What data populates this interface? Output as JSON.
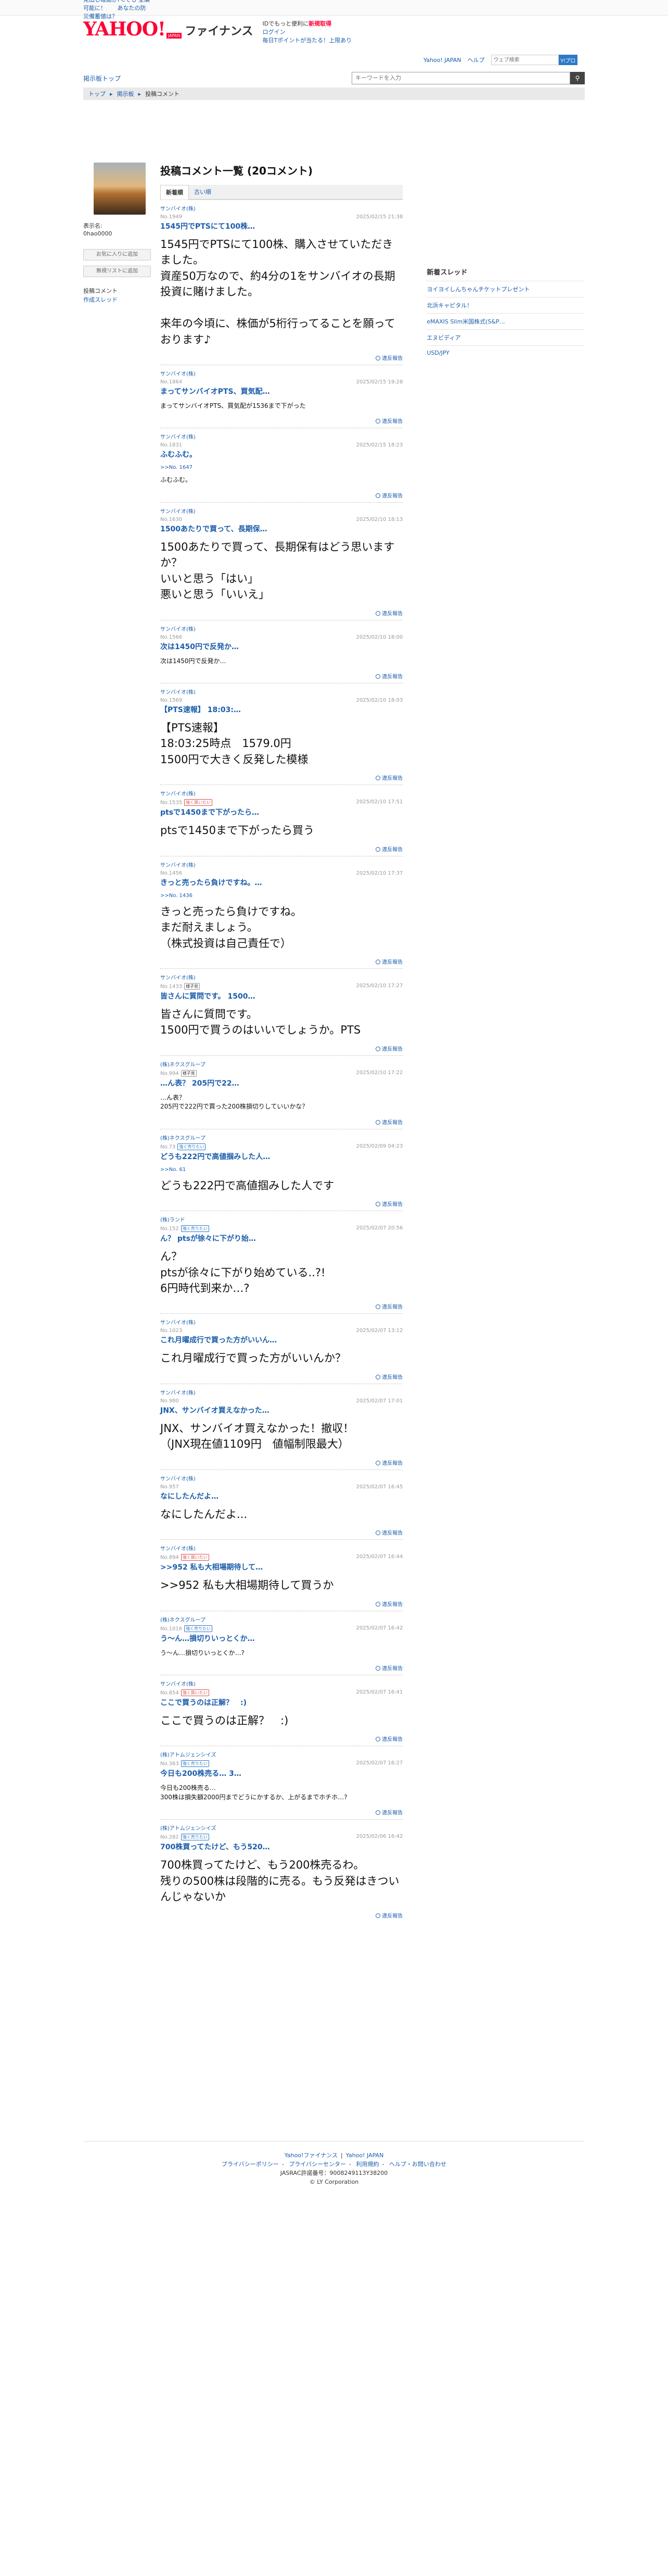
{
  "topbar": {
    "links": [
      "見出し確認がPCでも 全編可能に！",
      "あなたの防災備蓄値は？"
    ],
    "right_links": [
      "Yahoo! JAPAN",
      "ヘルプ"
    ],
    "search_placeholder": "ウェブ検索",
    "search_button": "Y!プロ"
  },
  "header": {
    "logo": "YAHOO!",
    "logo_japan": "JAPAN",
    "logo_sub": "ファイナンス",
    "info_line1": "IDでもっと便利に",
    "info_new": "新規取得",
    "info_line2": "ログイン",
    "info_line3": "毎日Tポイントが当たる！上限あり"
  },
  "nav": {
    "board_top": "掲示板トップ",
    "search_placeholder": "キーワードを入力"
  },
  "breadcrumb": [
    "トップ",
    "掲示板",
    "投稿コメント"
  ],
  "profile": {
    "name_label": "表示名:",
    "name": "0hao0000",
    "add_favorite": "お気に入りに追加",
    "add_ignore": "無視リストに追加",
    "link_comments": "投稿コメント",
    "link_threads": "作成スレッド"
  },
  "main": {
    "title": "投稿コメント一覧 (20コメント)",
    "tabs": [
      "新着順",
      "古い順"
    ],
    "report_label": "違反報告"
  },
  "posts": [
    {
      "stock": "サンバイオ(株)",
      "no": "No.1949",
      "date": "2025/02/15 21:38",
      "title": "1545円でPTSにて100株…",
      "badge": "",
      "reply": "",
      "size": "big",
      "body": "1545円でPTSにて100株、購入させていただきました。\n資産50万なので、約4分の1をサンバイオの長期投資に賭けました。\n\n来年の今頃に、株価が5桁行ってることを願っております♪"
    },
    {
      "stock": "サンバイオ(株)",
      "no": "No.1864",
      "date": "2025/02/15 19:28",
      "title": "まってサンバイオPTS、買気配…",
      "badge": "",
      "reply": "",
      "size": "small",
      "body": "まってサンバイオPTS、買気配が1536まで下がった"
    },
    {
      "stock": "サンバイオ(株)",
      "no": "No.1831",
      "date": "2025/02/15 18:23",
      "title": "ふむふむ。",
      "badge": "",
      "reply": ">>No. 1647",
      "size": "small",
      "body": "ふむふむ。"
    },
    {
      "stock": "サンバイオ(株)",
      "no": "No.1630",
      "date": "2025/02/10 18:13",
      "title": "1500あたりで買って、長期保…",
      "badge": "",
      "reply": "",
      "size": "big",
      "body": "1500あたりで買って、長期保有はどう思いますか？\nいいと思う「はい」\n悪いと思う「いいえ」"
    },
    {
      "stock": "サンバイオ(株)",
      "no": "No.1566",
      "date": "2025/02/10 18:00",
      "title": "次は1450円で反発か…",
      "badge": "",
      "reply": "",
      "size": "small",
      "body": "次は1450円で反発か…"
    },
    {
      "stock": "サンバイオ(株)",
      "no": "No.1569",
      "date": "2025/02/10 18:03",
      "title": "【PTS速報】 18:03:…",
      "badge": "",
      "reply": "",
      "size": "big",
      "body": "【PTS速報】\n18:03:25時点　1579.0円\n1500円で大きく反発した模様"
    },
    {
      "stock": "サンバイオ(株)",
      "no": "No.1535",
      "date": "2025/02/10 17:51",
      "title": "ptsで1450まで下がったら…",
      "badge": "強く買いたい",
      "reply": "",
      "size": "big",
      "body": "ptsで1450まで下がったら買う"
    },
    {
      "stock": "サンバイオ(株)",
      "no": "No.1456",
      "date": "2025/02/10 17:37",
      "title": "きっと売ったら負けですね。…",
      "badge": "",
      "reply": ">>No. 1436",
      "size": "big",
      "body": "きっと売ったら負けですね。\nまだ耐えましょう。\n（株式投資は自己責任で）"
    },
    {
      "stock": "サンバイオ(株)",
      "no": "No.1433",
      "date": "2025/02/10 17:27",
      "title": "皆さんに質問です。 1500…",
      "badge": "様子見",
      "reply": "",
      "size": "big",
      "body": "皆さんに質問です。\n1500円で買うのはいいでしょうか。PTS"
    },
    {
      "stock": "(株)ネクスグループ",
      "no": "No.994",
      "date": "2025/02/10 17:22",
      "title": "…ん表？ 205円で22…",
      "badge": "様子見",
      "reply": "",
      "size": "small",
      "body": "…ん表？\n205円で222円で買った200株損切りしていいかな？"
    },
    {
      "stock": "(株)ネクスグループ",
      "no": "No.73",
      "date": "2025/02/09 04:23",
      "title": "どうも222円で高値掴みした人…",
      "badge": "強く売りたい",
      "reply": ">>No. 61",
      "size": "big",
      "body": "どうも222円で高値掴みした人です"
    },
    {
      "stock": "(株)ランド",
      "no": "No.152",
      "date": "2025/02/07 20:56",
      "title": "ん？ ptsが徐々に下がり始…",
      "badge": "強く売りたい",
      "reply": "",
      "size": "big",
      "body": "ん？\nptsが徐々に下がり始めている..?!\n6円時代到来か…?"
    },
    {
      "stock": "サンバイオ(株)",
      "no": "No.1023",
      "date": "2025/02/07 13:12",
      "title": "これ月曜成行で買った方がいいん…",
      "badge": "",
      "reply": "",
      "size": "big",
      "body": "これ月曜成行で買った方がいいんか？"
    },
    {
      "stock": "サンバイオ(株)",
      "no": "No.980",
      "date": "2025/02/07 17:01",
      "title": "JNX、サンバイオ買えなかった…",
      "badge": "",
      "reply": "",
      "size": "big",
      "body": "JNX、サンバイオ買えなかった！撤収！\n（JNX現在値1109円　値幅制限最大）"
    },
    {
      "stock": "サンバイオ(株)",
      "no": "No.957",
      "date": "2025/02/07 16:45",
      "title": "なにしたんだよ…",
      "badge": "",
      "reply": "",
      "size": "big",
      "body": "なにしたんだよ..."
    },
    {
      "stock": "サンバイオ(株)",
      "no": "No.894",
      "date": "2025/02/07 16:44",
      "title": ">>952 私も大相場期待して…",
      "badge": "強く買いたい",
      "reply": "",
      "size": "big",
      "body": ">>952 私も大相場期待して買うか"
    },
    {
      "stock": "(株)ネクスグループ",
      "no": "No.1016",
      "date": "2025/02/07 16:42",
      "title": "う〜ん…損切りいっとくか…",
      "badge": "強く売りたい",
      "reply": "",
      "size": "small",
      "body": "う〜ん…損切りいっとくか…?"
    },
    {
      "stock": "サンバイオ(株)",
      "no": "No.854",
      "date": "2025/02/07 16:41",
      "title": "ここで買うのは正解？　:)",
      "badge": "強く買いたい",
      "reply": "",
      "size": "big",
      "body": "ここで買うのは正解？　:)"
    },
    {
      "stock": "(株)アトムジェンシイズ",
      "no": "No.363",
      "date": "2025/02/07 16:27",
      "title": "今日も200株売る… 3…",
      "badge": "強く売りたい",
      "reply": "",
      "size": "small",
      "body": "今日も200株売る…\n300株は損失額2000円までどうにかするか、上がるまでホチホ…?"
    },
    {
      "stock": "(株)アトムジェンシイズ",
      "no": "No.282",
      "date": "2025/02/06 16:42",
      "title": "700株買ってたけど、もう520…",
      "badge": "強く売りたい",
      "reply": "",
      "size": "big",
      "body": "700株買ってたけど、もう200株売るわ。\n残りの500株は段階的に売る。もう反発はきついんじゃないか"
    }
  ],
  "threads": {
    "title": "新着スレッド",
    "items": [
      "ヨイヨイしんちゃんチケットプレゼント",
      "北浜キャピタル！",
      "eMAXIS Slim米国株式(S&P…",
      "エヌビディア",
      "USD/JPY"
    ]
  },
  "footer": {
    "line1": [
      "Yahoo!ファイナンス",
      "Yahoo! JAPAN"
    ],
    "line2": [
      "プライバシーポリシー",
      "プライバシーセンター",
      "利用規約",
      "ヘルプ・お問い合わせ"
    ],
    "jasrac": "JASRAC許諾番号：9008249113Y38200",
    "copyright": "© LY Corporation"
  }
}
